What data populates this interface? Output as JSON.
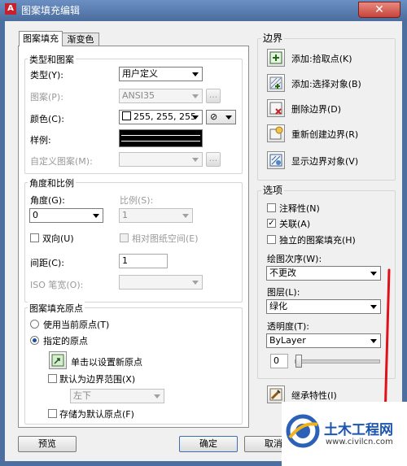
{
  "window": {
    "title": "图案填充编辑",
    "close_glyph": "✕",
    "app_glyph": "A"
  },
  "tabs": [
    {
      "label": "图案填充"
    },
    {
      "label": "渐变色"
    }
  ],
  "type_pattern": {
    "group_title": "类型和图案",
    "type_label": "类型(Y):",
    "type_value": "用户定义",
    "pattern_label": "图案(P):",
    "pattern_value": "ANSI35",
    "color_label": "颜色(C):",
    "color_value": "255, 255, 255",
    "bg_color_glyph": "⊘",
    "sample_label": "样例:",
    "custom_label": "自定义图案(M):",
    "ellipsis": "..."
  },
  "angle_scale": {
    "group_title": "角度和比例",
    "angle_label": "角度(G):",
    "angle_value": "0",
    "scale_label": "比例(S):",
    "scale_value": "1",
    "double_label": "双向(U)",
    "relative_label": "相对图纸空间(E)",
    "spacing_label": "间距(C):",
    "spacing_value": "1",
    "iso_label": "ISO 笔宽(O):"
  },
  "origin": {
    "group_title": "图案填充原点",
    "use_current_label": "使用当前原点(T)",
    "specified_label": "指定的原点",
    "click_set_label": "单击以设置新原点",
    "default_extents_label": "默认为边界范围(X)",
    "position_value": "左下",
    "store_default_label": "存储为默认原点(F)"
  },
  "boundaries": {
    "group_title": "边界",
    "items": [
      {
        "label": "添加:拾取点(K)",
        "icon": "pick-point-icon"
      },
      {
        "label": "添加:选择对象(B)",
        "icon": "select-objects-icon"
      },
      {
        "label": "删除边界(D)",
        "icon": "remove-boundary-icon"
      },
      {
        "label": "重新创建边界(R)",
        "icon": "recreate-boundary-icon"
      },
      {
        "label": "显示边界对象(V)",
        "icon": "view-selections-icon"
      }
    ]
  },
  "options": {
    "group_title": "选项",
    "annotative_label": "注释性(N)",
    "associative_label": "关联(A)",
    "separate_label": "独立的图案填充(H)",
    "draw_order_label": "绘图次序(W):",
    "draw_order_value": "不更改",
    "layer_label": "图层(L):",
    "layer_value": "绿化",
    "transparency_label": "透明度(T):",
    "transparency_value": "ByLayer",
    "transparency_number": "0"
  },
  "inherit_label": "继承特性(I)",
  "footer": {
    "preview_label": "预览",
    "ok_label": "确定",
    "cancel_label": "取消"
  },
  "watermark": {
    "name": "土木工程网",
    "url": "www.civilcn.com"
  },
  "colors": {
    "annotation_red": "#e0101a",
    "title_blue": "#4d6fa0"
  }
}
